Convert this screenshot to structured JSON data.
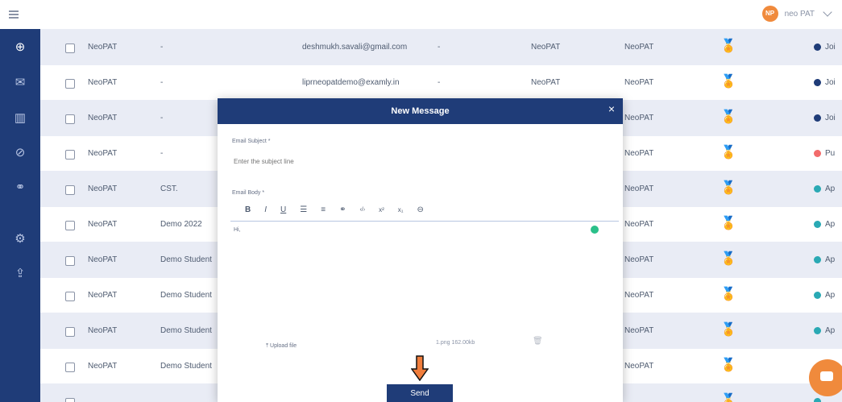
{
  "header": {
    "user_initials": "NP",
    "user_name": "neo PAT"
  },
  "sidebar": {
    "items": [
      {
        "icon": "globe-icon",
        "glyph": "⊕"
      },
      {
        "icon": "mail-icon",
        "glyph": "✉"
      },
      {
        "icon": "chart-icon",
        "glyph": "▥"
      },
      {
        "icon": "check-circle-icon",
        "glyph": "⊘"
      },
      {
        "icon": "link-icon",
        "glyph": "⚭"
      },
      {
        "icon": "settings-icon",
        "glyph": "⚙"
      },
      {
        "icon": "upload-icon",
        "glyph": "⇪"
      }
    ]
  },
  "table": {
    "rows": [
      {
        "org": "NeoPAT",
        "name": "-",
        "email": "deshmukh.savali@gmail.com",
        "phone": "-",
        "college": "NeoPAT",
        "company": "NeoPAT",
        "status": "Joi",
        "status_color": "#1f3c78"
      },
      {
        "org": "NeoPAT",
        "name": "-",
        "email": "liprneopatdemo@examly.in",
        "phone": "-",
        "college": "NeoPAT",
        "company": "NeoPAT",
        "status": "Joi",
        "status_color": "#1f3c78"
      },
      {
        "org": "NeoPAT",
        "name": "-",
        "email": "",
        "phone": "",
        "college": "",
        "company": "NeoPAT",
        "status": "Joi",
        "status_color": "#1f3c78"
      },
      {
        "org": "NeoPAT",
        "name": "-",
        "email": "",
        "phone": "",
        "college": "",
        "company": "NeoPAT",
        "status": "Pu",
        "status_color": "#f26b6b"
      },
      {
        "org": "NeoPAT",
        "name": "CST.",
        "email": "",
        "phone": "",
        "college": "",
        "company": "NeoPAT",
        "status": "Ap",
        "status_color": "#2aa9b4"
      },
      {
        "org": "NeoPAT",
        "name": "Demo 2022",
        "email": "",
        "phone": "",
        "college": "",
        "company": "NeoPAT",
        "status": "Ap",
        "status_color": "#2aa9b4"
      },
      {
        "org": "NeoPAT",
        "name": "Demo Student",
        "email": "",
        "phone": "",
        "college": "",
        "company": "NeoPAT",
        "status": "Ap",
        "status_color": "#2aa9b4"
      },
      {
        "org": "NeoPAT",
        "name": "Demo Student",
        "email": "",
        "phone": "",
        "college": "",
        "company": "NeoPAT",
        "status": "Ap",
        "status_color": "#2aa9b4"
      },
      {
        "org": "NeoPAT",
        "name": "Demo Student",
        "email": "",
        "phone": "",
        "college": "",
        "company": "NeoPAT",
        "status": "Ap",
        "status_color": "#2aa9b4"
      },
      {
        "org": "NeoPAT",
        "name": "Demo Student",
        "email": "",
        "phone": "",
        "college": "",
        "company": "NeoPAT",
        "status": "",
        "status_color": ""
      },
      {
        "org": "",
        "name": "",
        "email": "",
        "phone": "",
        "college": "",
        "company": "",
        "status": "",
        "status_color": "#2aa9b4"
      }
    ]
  },
  "modal": {
    "title": "New Message",
    "close_label": "×",
    "subject_label": "Email Subject *",
    "subject_placeholder": "Enter the subject line",
    "body_label": "Email Body *",
    "toolbar": [
      "B",
      "I",
      "U",
      "☰",
      "≡",
      "⚭",
      "‹/›",
      "x²",
      "x₁",
      "⊖"
    ],
    "body_text": "Hi,",
    "upload_label": "⤒ Upload file",
    "file_name": "1.png 162.00kb",
    "send_label": "Send"
  }
}
